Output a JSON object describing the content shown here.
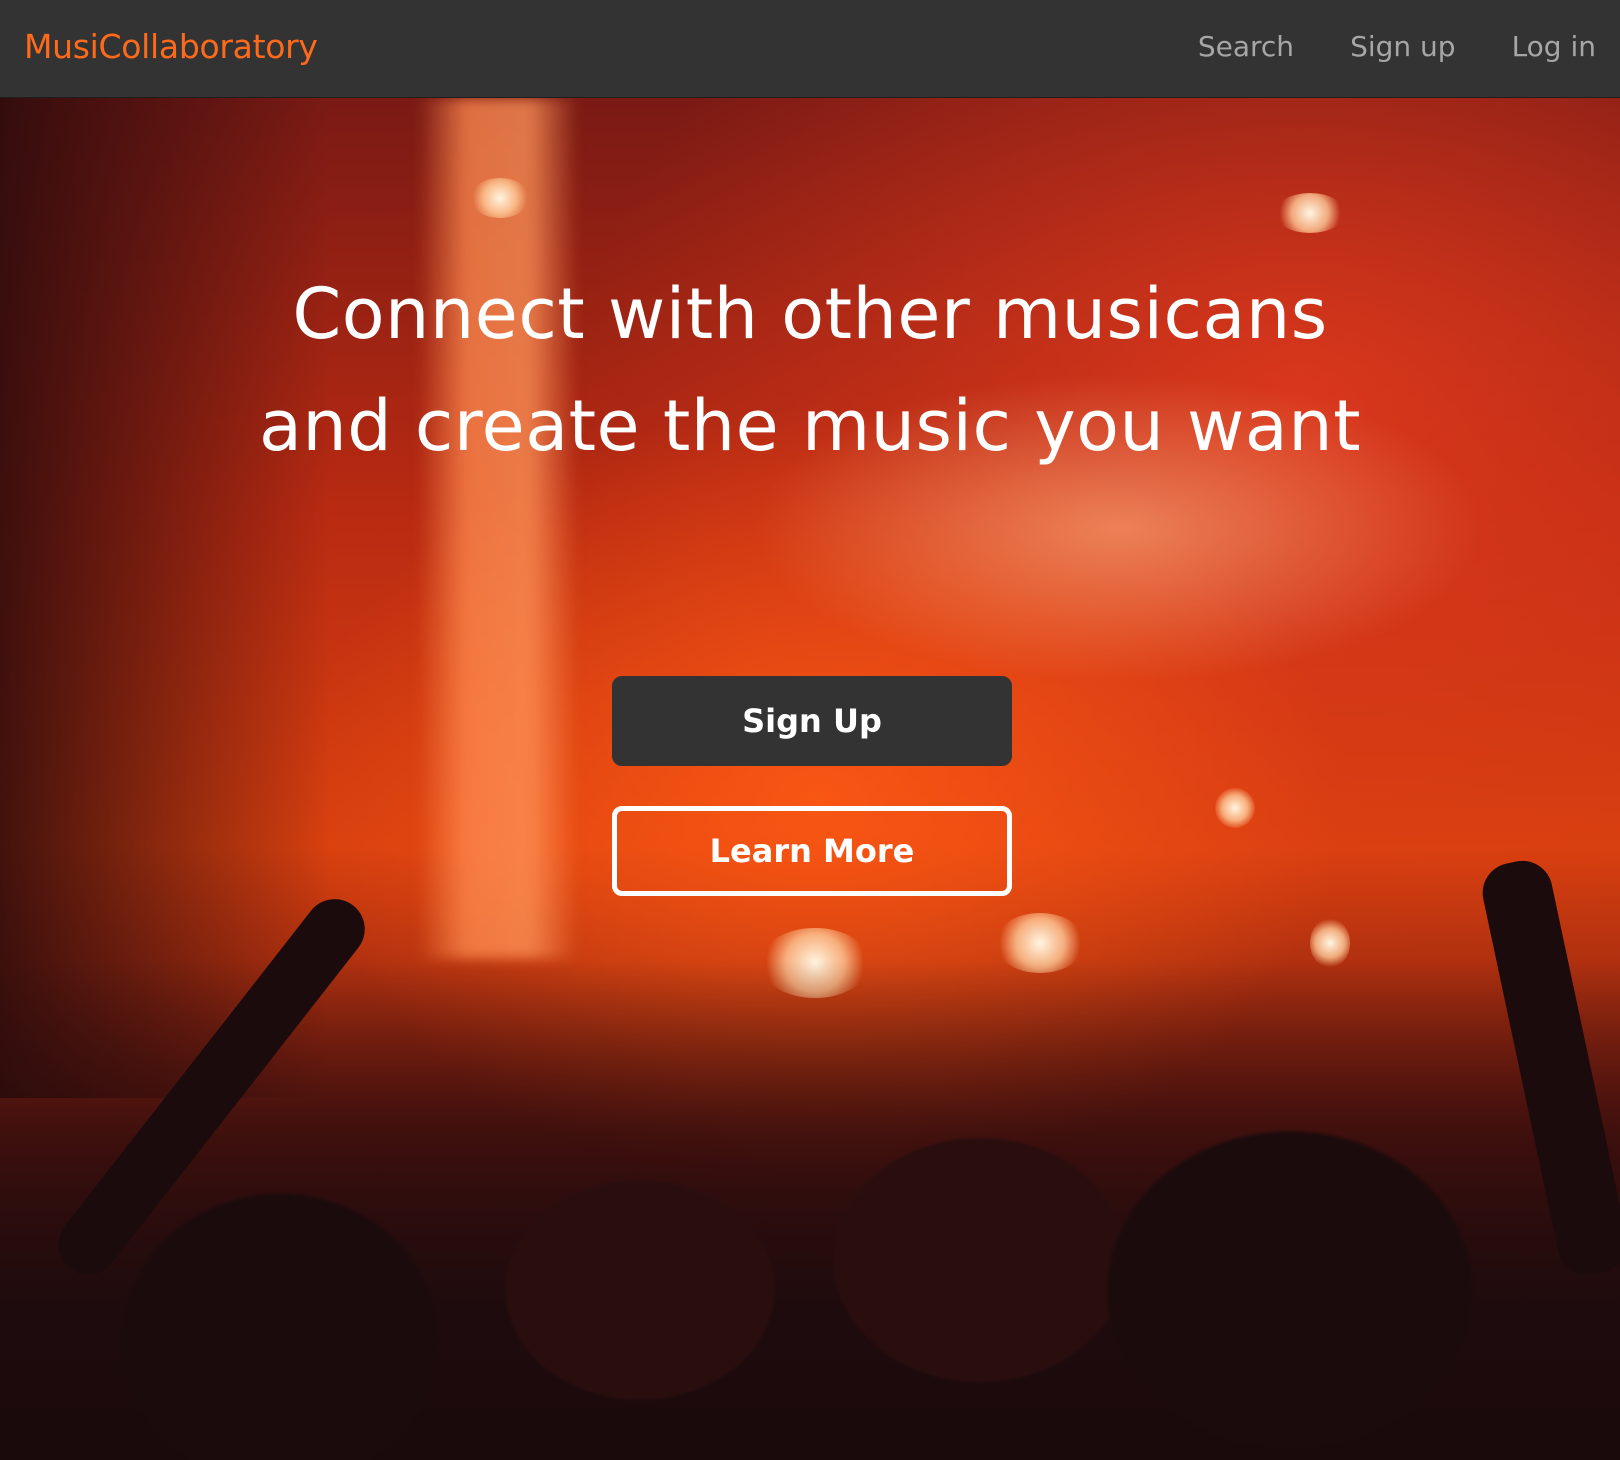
{
  "navbar": {
    "brand": "MusiCollaboratory",
    "links": [
      {
        "label": "Search"
      },
      {
        "label": "Sign up"
      },
      {
        "label": "Log in"
      }
    ]
  },
  "hero": {
    "headline_line1": "Connect with other musicans",
    "headline_line2": "and create the music you want",
    "signup_button": "Sign Up",
    "learn_more_button": "Learn More"
  },
  "colors": {
    "brand": "#ff6a1a",
    "navbar_bg": "#333333",
    "nav_link": "#a6a6a6",
    "primary_button_bg": "#333333",
    "text_light": "#ffffff"
  }
}
